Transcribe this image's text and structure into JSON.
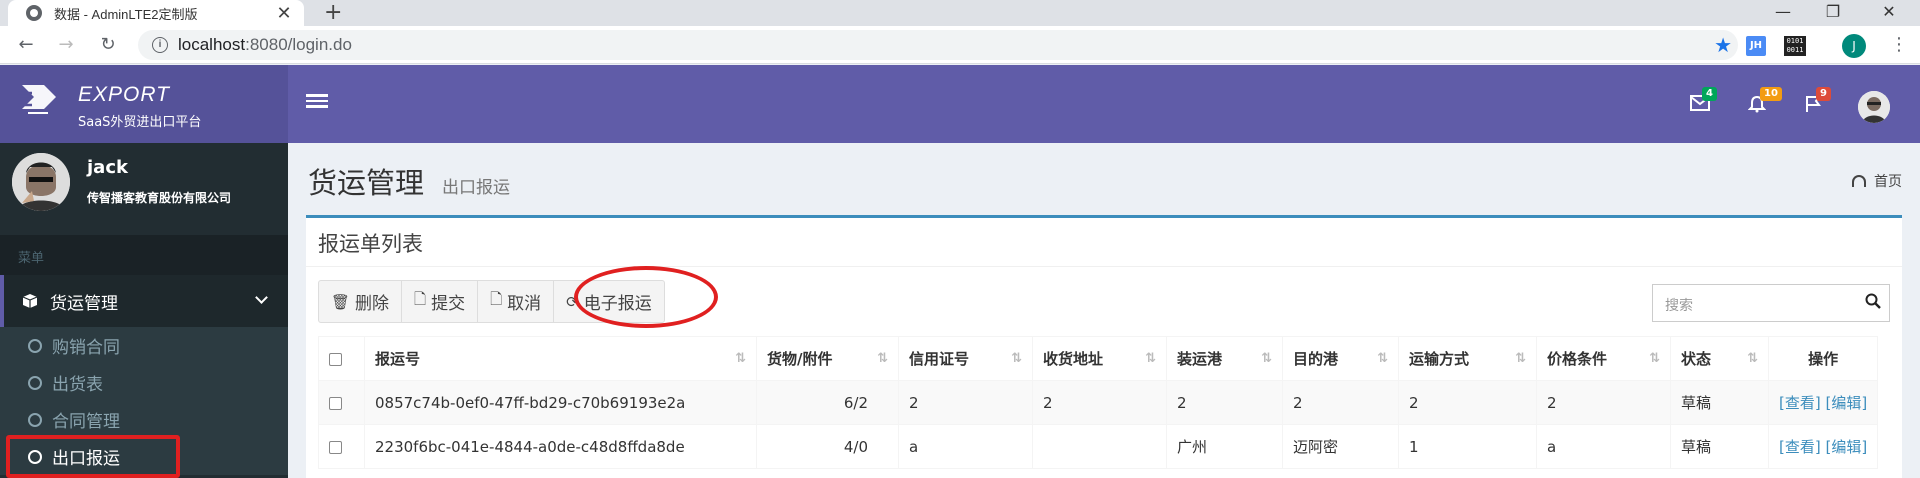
{
  "browser": {
    "tab_title": "数据 - AdminLTE2定制版",
    "url_host": "localhost",
    "url_rest": ":8080/login.do",
    "ext_jh": "JH",
    "ext_binary": "0101 0011",
    "profile_initial": "J"
  },
  "header": {
    "brand": "EXPORT",
    "tagline": "SaaS外贸进出口平台",
    "mail_count": "4",
    "notify_count": "10",
    "flag_count": "9"
  },
  "sidebar": {
    "user_name": "jack",
    "company": "传智播客教育股份有限公司",
    "menu_header": "菜单",
    "parent_label": "货运管理",
    "items": [
      {
        "label": "购销合同"
      },
      {
        "label": "出货表"
      },
      {
        "label": "合同管理"
      },
      {
        "label": "出口报运"
      }
    ]
  },
  "page": {
    "title": "货运管理",
    "subtitle": "出口报运",
    "breadcrumb": "首页",
    "box_title": "报运单列表",
    "search_placeholder": "搜索"
  },
  "toolbar": {
    "delete": "删除",
    "submit": "提交",
    "cancel": "取消",
    "electronic": "电子报运"
  },
  "table": {
    "headers": [
      "报运号",
      "货物/附件",
      "信用证号",
      "收货地址",
      "装运港",
      "目的港",
      "运输方式",
      "价格条件",
      "状态",
      "操作"
    ],
    "rows": [
      {
        "id": "0857c74b-0ef0-47ff-bd29-c70b69193e2a",
        "goods": "6/2",
        "lc": "2",
        "addr": "2",
        "port_from": "2",
        "port_to": "2",
        "transport": "2",
        "price": "2",
        "status": "草稿",
        "view": "[查看]",
        "edit": "[编辑]"
      },
      {
        "id": "2230f6bc-041e-4844-a0de-c48d8ffda8de",
        "goods": "4/0",
        "lc": "a",
        "addr": "",
        "port_from": "广州",
        "port_to": "迈阿密",
        "transport": "1",
        "price": "a",
        "status": "草稿",
        "view": "[查看]",
        "edit": "[编辑]"
      }
    ]
  },
  "colors": {
    "header_bg": "#605ca8",
    "logo_bg": "#555299",
    "sidebar_bg": "#222d32",
    "box_border": "#3c8dbc",
    "highlight": "#e02020"
  }
}
